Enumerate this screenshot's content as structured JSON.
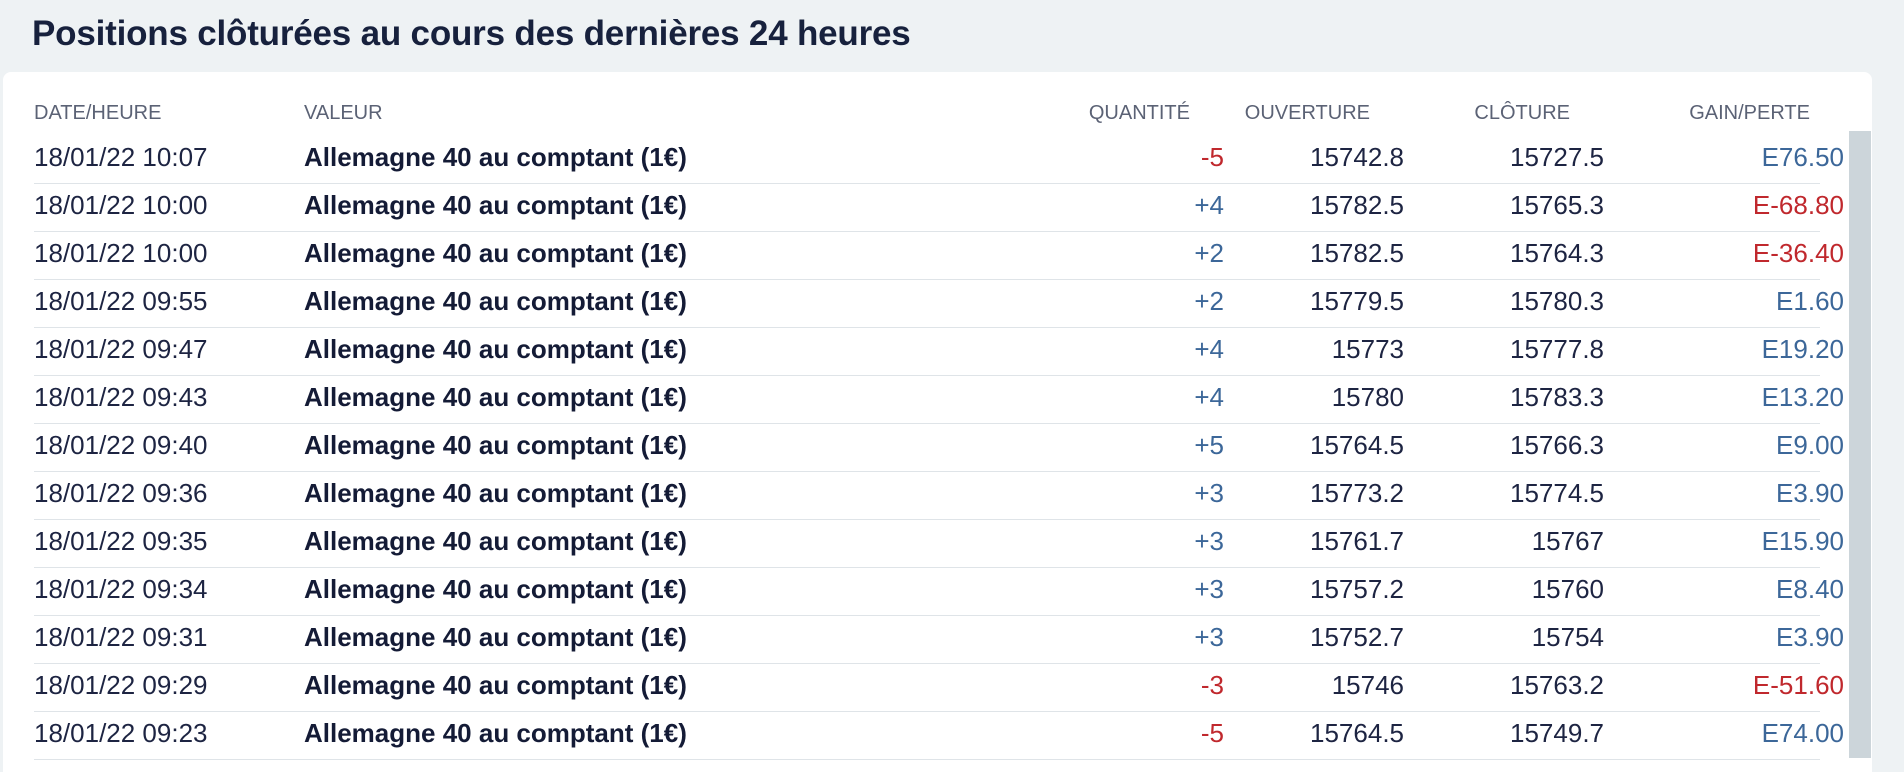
{
  "title": "Positions clôturées au cours des dernières 24 heures",
  "columns": {
    "date": "DATE/HEURE",
    "valeur": "VALEUR",
    "quantite": "QUANTITÉ",
    "ouverture": "OUVERTURE",
    "cloture": "CLÔTURE",
    "gain": "GAIN/PERTE"
  },
  "colors": {
    "positive": "#3c6799",
    "negative": "#c0282d"
  },
  "rows": [
    {
      "date": "18/01/22 10:07",
      "valeur": "Allemagne 40 au comptant (1€)",
      "quantite": "-5",
      "ouverture": "15742.8",
      "cloture": "15727.5",
      "gain": "E76.50",
      "qty_sign": "neg",
      "gain_sign": "pos"
    },
    {
      "date": "18/01/22 10:00",
      "valeur": "Allemagne 40 au comptant (1€)",
      "quantite": "+4",
      "ouverture": "15782.5",
      "cloture": "15765.3",
      "gain": "E-68.80",
      "qty_sign": "pos",
      "gain_sign": "neg"
    },
    {
      "date": "18/01/22 10:00",
      "valeur": "Allemagne 40 au comptant (1€)",
      "quantite": "+2",
      "ouverture": "15782.5",
      "cloture": "15764.3",
      "gain": "E-36.40",
      "qty_sign": "pos",
      "gain_sign": "neg"
    },
    {
      "date": "18/01/22 09:55",
      "valeur": "Allemagne 40 au comptant (1€)",
      "quantite": "+2",
      "ouverture": "15779.5",
      "cloture": "15780.3",
      "gain": "E1.60",
      "qty_sign": "pos",
      "gain_sign": "pos"
    },
    {
      "date": "18/01/22 09:47",
      "valeur": "Allemagne 40 au comptant (1€)",
      "quantite": "+4",
      "ouverture": "15773",
      "cloture": "15777.8",
      "gain": "E19.20",
      "qty_sign": "pos",
      "gain_sign": "pos"
    },
    {
      "date": "18/01/22 09:43",
      "valeur": "Allemagne 40 au comptant (1€)",
      "quantite": "+4",
      "ouverture": "15780",
      "cloture": "15783.3",
      "gain": "E13.20",
      "qty_sign": "pos",
      "gain_sign": "pos"
    },
    {
      "date": "18/01/22 09:40",
      "valeur": "Allemagne 40 au comptant (1€)",
      "quantite": "+5",
      "ouverture": "15764.5",
      "cloture": "15766.3",
      "gain": "E9.00",
      "qty_sign": "pos",
      "gain_sign": "pos"
    },
    {
      "date": "18/01/22 09:36",
      "valeur": "Allemagne 40 au comptant (1€)",
      "quantite": "+3",
      "ouverture": "15773.2",
      "cloture": "15774.5",
      "gain": "E3.90",
      "qty_sign": "pos",
      "gain_sign": "pos"
    },
    {
      "date": "18/01/22 09:35",
      "valeur": "Allemagne 40 au comptant (1€)",
      "quantite": "+3",
      "ouverture": "15761.7",
      "cloture": "15767",
      "gain": "E15.90",
      "qty_sign": "pos",
      "gain_sign": "pos"
    },
    {
      "date": "18/01/22 09:34",
      "valeur": "Allemagne 40 au comptant (1€)",
      "quantite": "+3",
      "ouverture": "15757.2",
      "cloture": "15760",
      "gain": "E8.40",
      "qty_sign": "pos",
      "gain_sign": "pos"
    },
    {
      "date": "18/01/22 09:31",
      "valeur": "Allemagne 40 au comptant (1€)",
      "quantite": "+3",
      "ouverture": "15752.7",
      "cloture": "15754",
      "gain": "E3.90",
      "qty_sign": "pos",
      "gain_sign": "pos"
    },
    {
      "date": "18/01/22 09:29",
      "valeur": "Allemagne 40 au comptant (1€)",
      "quantite": "-3",
      "ouverture": "15746",
      "cloture": "15763.2",
      "gain": "E-51.60",
      "qty_sign": "neg",
      "gain_sign": "neg"
    },
    {
      "date": "18/01/22 09:23",
      "valeur": "Allemagne 40 au comptant (1€)",
      "quantite": "-5",
      "ouverture": "15764.5",
      "cloture": "15749.7",
      "gain": "E74.00",
      "qty_sign": "neg",
      "gain_sign": "pos"
    }
  ]
}
